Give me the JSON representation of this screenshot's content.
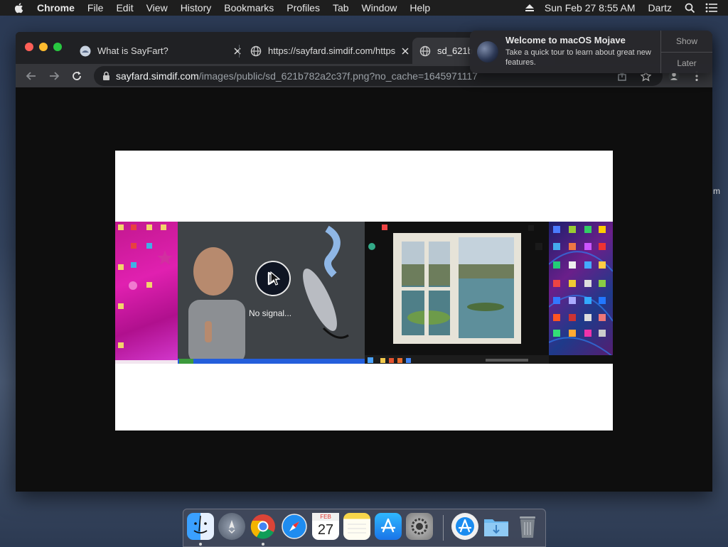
{
  "menubar": {
    "app_name": "Chrome",
    "items": [
      "File",
      "Edit",
      "View",
      "History",
      "Bookmarks",
      "Profiles",
      "Tab",
      "Window",
      "Help"
    ],
    "datetime": "Sun Feb 27  8:55 AM",
    "user": "Dartz"
  },
  "tabs": [
    {
      "title": "What is SayFart?"
    },
    {
      "title": "https://sayfard.simdif.com/https://"
    },
    {
      "title": "sd_621b"
    }
  ],
  "address_bar": {
    "host": "sayfard.simdif.com",
    "path": "/images/public/sd_621b782a2c37f.png?no_cache=1645971117"
  },
  "image": {
    "overlay_text": "No signal..."
  },
  "notification": {
    "title": "Welcome to macOS Mojave",
    "body": "Take a quick tour to learn about great new features.",
    "show_label": "Show",
    "later_label": "Later"
  },
  "calendar": {
    "month": "FEB",
    "day": "27"
  },
  "side_text": "m",
  "dock_items": [
    "Finder",
    "Launchpad",
    "Google Chrome",
    "Safari",
    "Calendar",
    "Notes",
    "App Store",
    "System Preferences",
    "App Store Download",
    "Downloads",
    "Trash"
  ]
}
